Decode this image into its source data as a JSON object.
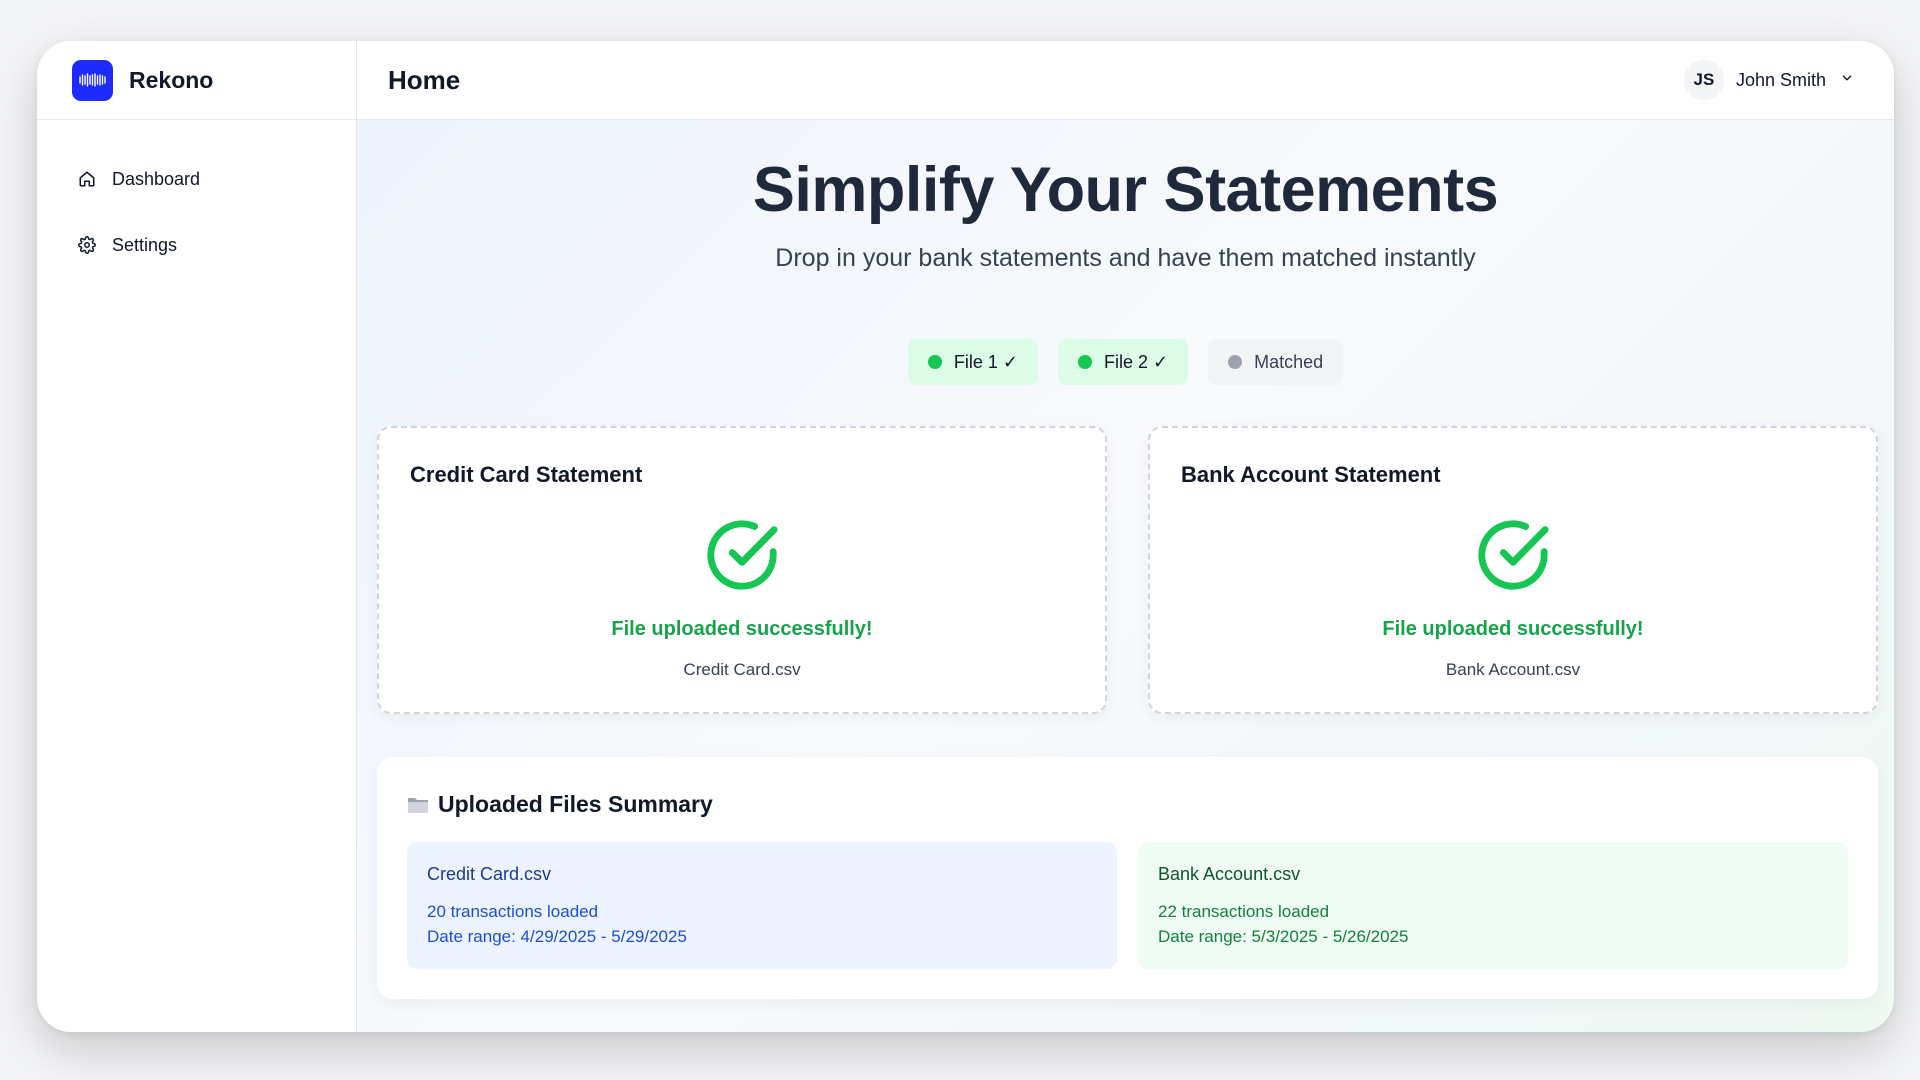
{
  "brand": {
    "name": "Rekono",
    "color": "#1d2bff"
  },
  "sidebar": {
    "items": [
      {
        "label": "Dashboard",
        "icon": "home-icon"
      },
      {
        "label": "Settings",
        "icon": "gear-icon"
      }
    ]
  },
  "header": {
    "title": "Home",
    "user": {
      "initials": "JS",
      "name": "John Smith"
    }
  },
  "hero": {
    "title": "Simplify Your Statements",
    "subtitle": "Drop in your bank statements and have them matched instantly"
  },
  "steps": [
    {
      "label": "File 1 ✓",
      "status": "done"
    },
    {
      "label": "File 2 ✓",
      "status": "done"
    },
    {
      "label": "Matched",
      "status": "pending"
    }
  ],
  "uploads": [
    {
      "title": "Credit Card Statement",
      "status_text": "File uploaded successfully!",
      "file_name": "Credit Card.csv"
    },
    {
      "title": "Bank Account Statement",
      "status_text": "File uploaded successfully!",
      "file_name": "Bank Account.csv"
    }
  ],
  "summary": {
    "title": "Uploaded Files Summary",
    "files": [
      {
        "name": "Credit Card.csv",
        "transactions": "20 transactions loaded",
        "date_range": "Date range: 4/29/2025 - 5/29/2025"
      },
      {
        "name": "Bank Account.csv",
        "transactions": "22 transactions loaded",
        "date_range": "Date range: 5/3/2025 - 5/26/2025"
      }
    ]
  },
  "colors": {
    "success": "#16a34a",
    "success_dot": "#16c653",
    "pending_dot": "#9ca3af"
  }
}
